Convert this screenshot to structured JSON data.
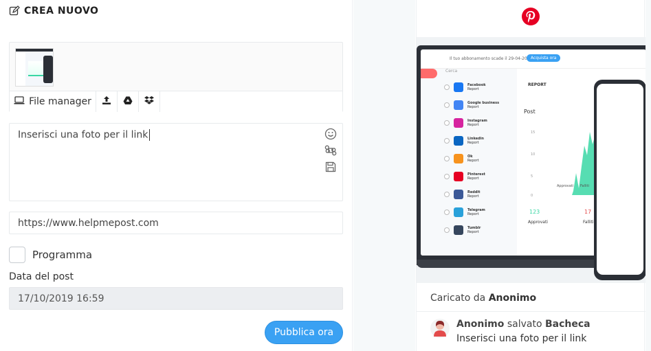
{
  "header": {
    "title": "CREA NUOVO"
  },
  "media": {
    "file_manager_label": "File manager",
    "icons": [
      "upload-icon",
      "google-drive-icon",
      "dropbox-icon"
    ]
  },
  "editor": {
    "text": "Inserisci una foto per  il link",
    "side_icons": [
      "smiley-icon",
      "command-icon",
      "save-icon"
    ]
  },
  "link_input": {
    "value": "https://www.helpmepost.com"
  },
  "schedule": {
    "label": "Programma",
    "checked": false
  },
  "post_date": {
    "label": "Data del post",
    "value": "17/10/2019 16:59"
  },
  "actions": {
    "publish_label": "Pubblica ora"
  },
  "preview": {
    "platform_icon": "pinterest-logo-icon",
    "uploaded_by_prefix": "Caricato da",
    "uploaded_by_name": "Anonimo",
    "activity": {
      "user": "Anonimo",
      "verb": "salvato",
      "board": "Bacheca",
      "text": "Inserisci una foto per  il link"
    },
    "screenshot": {
      "subscription_text": "Il tuo abbonamento scade il 29-04-2024",
      "buy_label": "Acquista ora",
      "search_placeholder": "Cerca",
      "report_label": "REPORT",
      "post_label": "Post",
      "approved_label": "Approvati",
      "failed_label": "Falliti",
      "approved_count": "123",
      "failed_count": "17",
      "approved_caption": "Approvati",
      "failed_caption": "Falliti",
      "y_ticks": [
        "15",
        "10",
        "5",
        "0"
      ],
      "accounts": [
        {
          "name": "Facebook",
          "sub": "Report",
          "color": "#1877f2"
        },
        {
          "name": "Google business",
          "sub": "Report",
          "color": "#4285f4"
        },
        {
          "name": "Instagram",
          "sub": "Report",
          "color": "#d6249f"
        },
        {
          "name": "Linkedin",
          "sub": "Report",
          "color": "#0a66c2"
        },
        {
          "name": "Ok",
          "sub": "Report",
          "color": "#f7931e"
        },
        {
          "name": "Pinterest",
          "sub": "Report",
          "color": "#e60023"
        },
        {
          "name": "Reddit",
          "sub": "Report",
          "color": "#3b5998"
        },
        {
          "name": "Telegram",
          "sub": "Report",
          "color": "#2aa1da"
        },
        {
          "name": "Tumblr",
          "sub": "Report",
          "color": "#36465d"
        }
      ]
    }
  },
  "colors": {
    "accent": "#3aa1f3",
    "pinterest": "#e60023",
    "chart_green": "#39d7a4",
    "input_disabled_bg": "#eceef1"
  }
}
